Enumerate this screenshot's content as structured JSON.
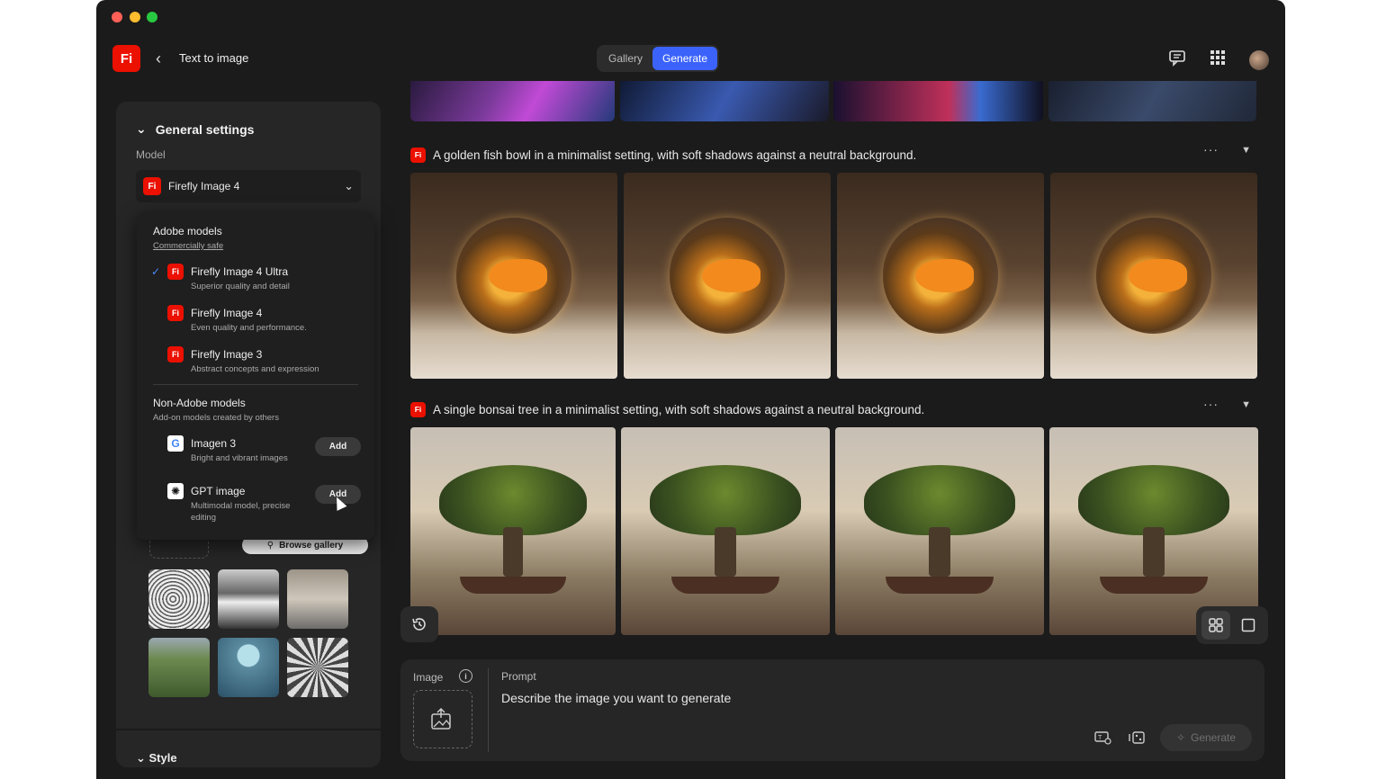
{
  "app": {
    "logo": "Fi",
    "title": "Text to image",
    "tabs": [
      {
        "label": "Gallery",
        "active": false
      },
      {
        "label": "Generate",
        "active": true
      }
    ],
    "header_icons": [
      "comment-icon",
      "apps-grid-icon",
      "avatar"
    ]
  },
  "sidebar": {
    "section_title": "General settings",
    "model_label": "Model",
    "model_selected": "Firefly Image 4",
    "browse_gallery": "Browse gallery",
    "style_section": "Style"
  },
  "dropdown": {
    "adobe_group": "Adobe models",
    "adobe_sub": "Commercially safe",
    "adobe_items": [
      {
        "name": "Firefly Image 4 Ultra",
        "desc": "Superior quality and detail",
        "checked": true
      },
      {
        "name": "Firefly Image 4",
        "desc": "Even quality and performance.",
        "checked": false
      },
      {
        "name": "Firefly Image 3",
        "desc": "Abstract concepts and expression",
        "checked": false
      }
    ],
    "nonadobe_group": "Non-Adobe models",
    "nonadobe_sub": "Add-on models created by others",
    "nonadobe_items": [
      {
        "name": "Imagen 3",
        "desc": "Bright and vibrant images",
        "action": "Add"
      },
      {
        "name": "GPT image",
        "desc": "Multimodal model, precise editing",
        "action": "Add"
      }
    ]
  },
  "results": [
    {
      "prompt": "A golden fish bowl in a minimalist setting, with soft shadows against a neutral background.",
      "more": "···"
    },
    {
      "prompt": "A single bonsai tree in a minimalist setting, with soft shadows against a neutral background.",
      "more": "···"
    }
  ],
  "prompt_panel": {
    "image_label": "Image",
    "info": "i",
    "prompt_label": "Prompt",
    "placeholder": "Describe the image you want to generate",
    "generate": "Generate"
  },
  "colors": {
    "accent": "#3b63fb",
    "brand": "#eb1000",
    "background": "#1b1b1b",
    "panel": "#262626"
  }
}
